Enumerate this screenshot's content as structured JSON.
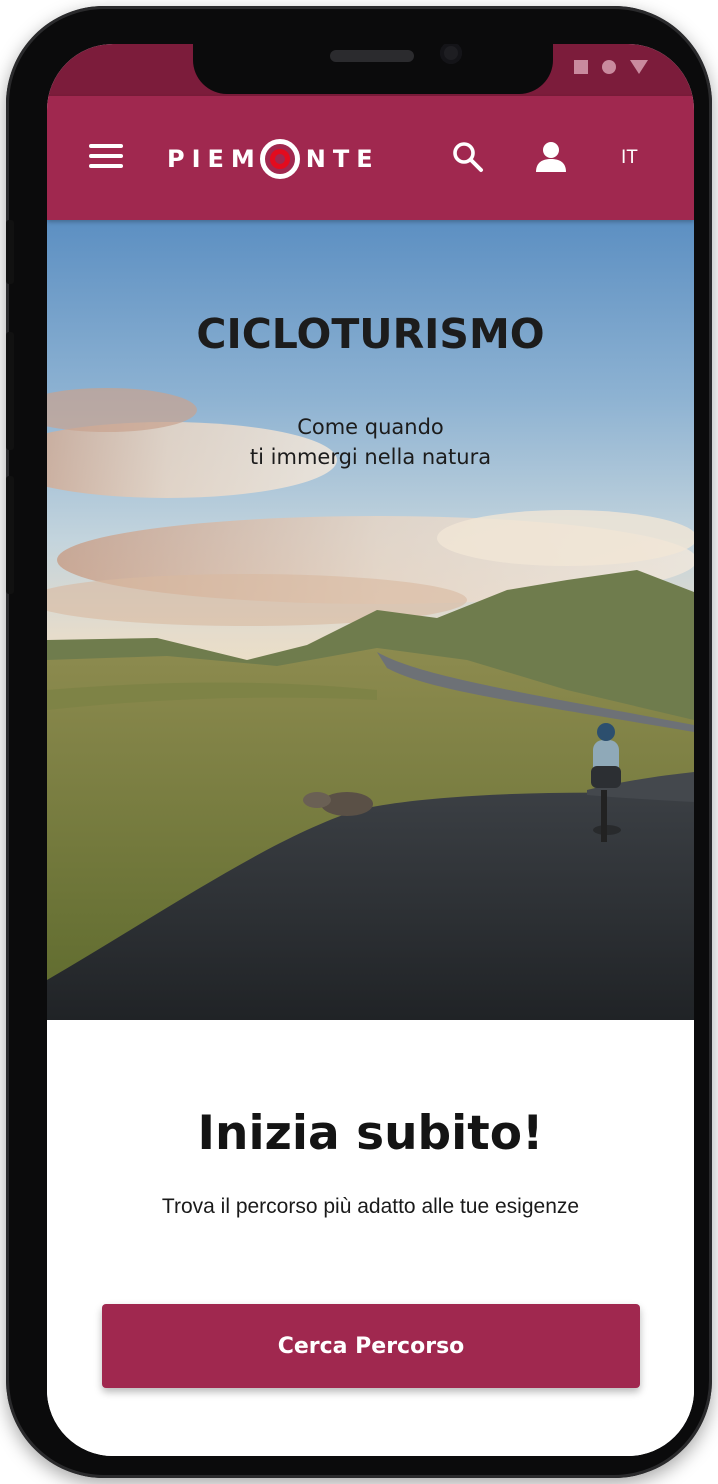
{
  "colors": {
    "brand": "#a0284f",
    "status_bar": "#7c1c3b",
    "logo_accent": "#e30b1e",
    "text_dark": "#141414",
    "background": "#ffffff"
  },
  "status_bar": {
    "icons": [
      "signal-square-icon",
      "wifi-dot-icon",
      "battery-triangle-icon"
    ]
  },
  "header": {
    "menu_icon": "hamburger-menu-icon",
    "logo_text_left": "PIEM",
    "logo_text_right": "NTE",
    "search_icon": "search-icon",
    "user_icon": "user-icon",
    "language": "IT"
  },
  "hero": {
    "title": "CICLOTURISMO",
    "subtitle_line1": "Come quando",
    "subtitle_line2": "ti immergi nella natura"
  },
  "cta": {
    "title": "Inizia subito!",
    "text": "Trova il percorso più adatto alle tue esigenze",
    "button_label": "Cerca Percorso"
  }
}
